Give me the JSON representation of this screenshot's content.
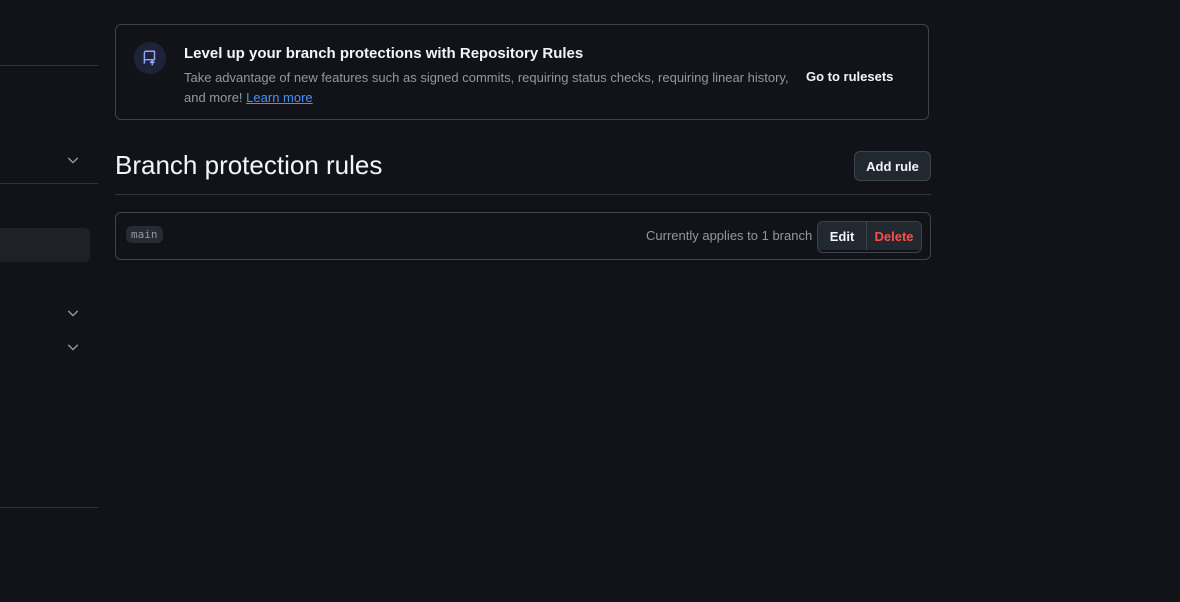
{
  "banner": {
    "icon": "repo-push-icon",
    "title": "Level up your branch protections with Repository Rules",
    "description": "Take advantage of new features such as signed commits, requiring status checks, requiring linear history, and more!",
    "learn_more": "Learn more",
    "cta": "Go to rulesets"
  },
  "section": {
    "title": "Branch protection rules",
    "add_rule": "Add rule"
  },
  "rules": [
    {
      "branch": "main",
      "applies": "Currently applies to 1 branch",
      "edit": "Edit",
      "delete": "Delete"
    }
  ],
  "colors": {
    "background": "#121318",
    "border": "#3d444d",
    "link": "#4493f8",
    "danger": "#f85149"
  }
}
